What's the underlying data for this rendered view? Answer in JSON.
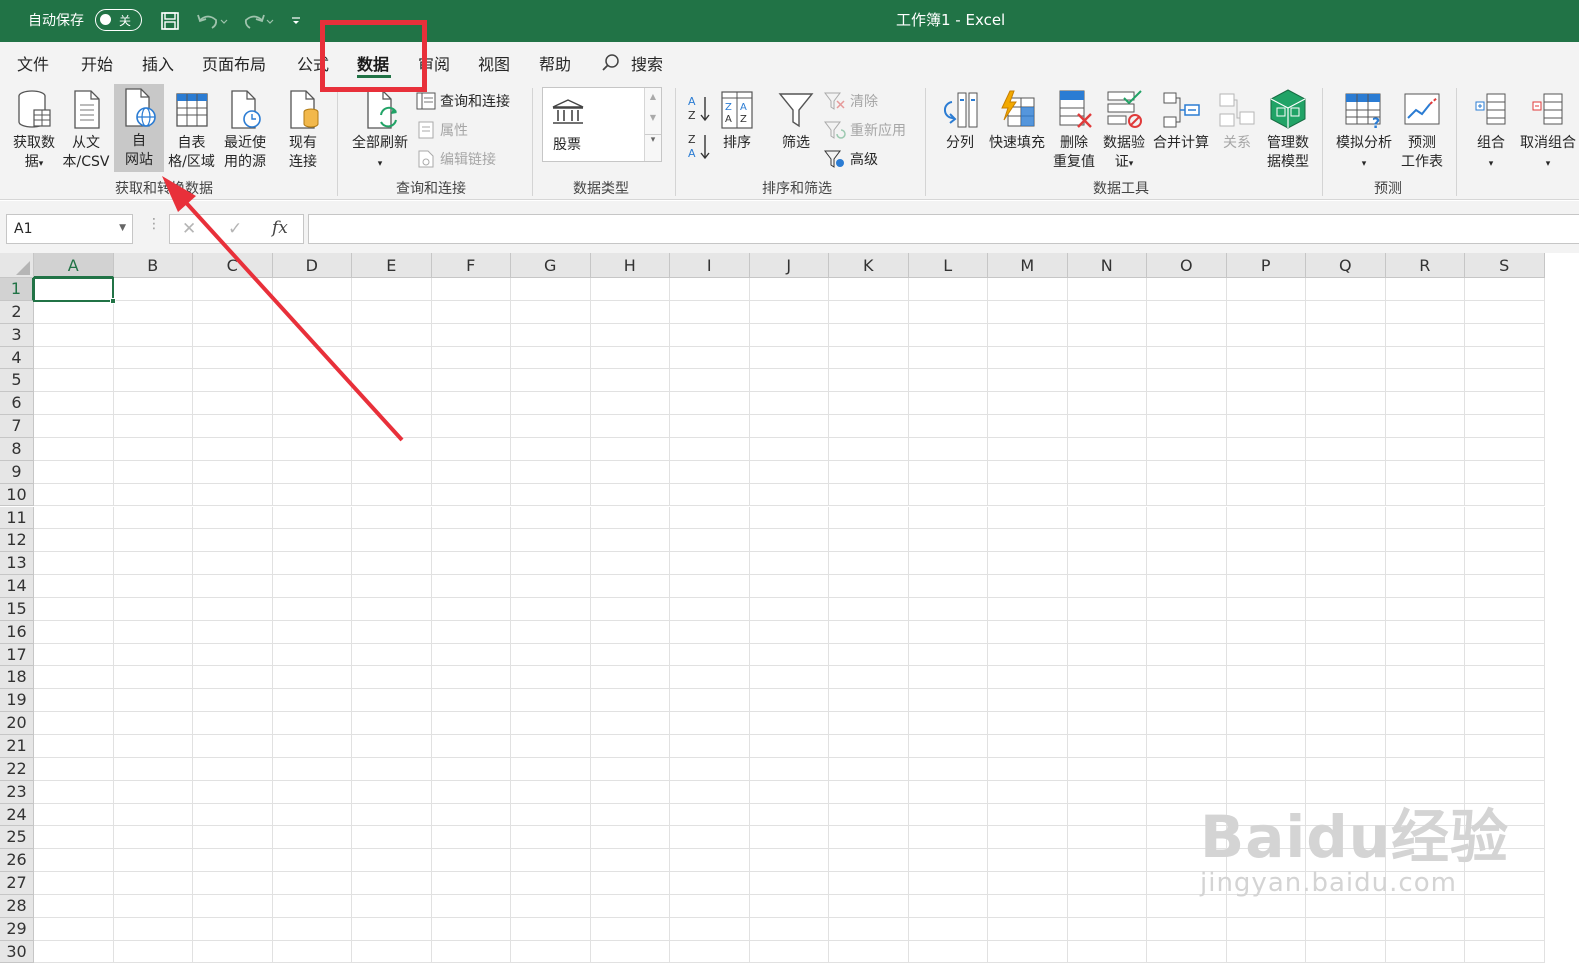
{
  "titlebar": {
    "autosave_label": "自动保存",
    "autosave_state": "关",
    "window_title": "工作簿1  -  Excel"
  },
  "tabs": [
    {
      "label": "文件"
    },
    {
      "label": "开始"
    },
    {
      "label": "插入"
    },
    {
      "label": "页面布局"
    },
    {
      "label": "公式"
    },
    {
      "label": "数据"
    },
    {
      "label": "审阅"
    },
    {
      "label": "视图"
    },
    {
      "label": "帮助"
    },
    {
      "label": "搜索"
    }
  ],
  "active_tab": "数据",
  "ribbon": {
    "get_data": {
      "group_label": "获取和转换数据",
      "buttons": [
        {
          "line1": "获取数",
          "line2": "据"
        },
        {
          "line1": "从文",
          "line2": "本/CSV"
        },
        {
          "line1": "自",
          "line2": "网站"
        },
        {
          "line1": "自表",
          "line2": "格/区域"
        },
        {
          "line1": "最近使",
          "line2": "用的源"
        },
        {
          "line1": "现有",
          "line2": "连接"
        }
      ]
    },
    "queries": {
      "group_label": "查询和连接",
      "refresh_all": "全部刷新",
      "queries_connections": "查询和连接",
      "properties": "属性",
      "edit_links": "编辑链接"
    },
    "data_types": {
      "group_label": "数据类型",
      "stocks": "股票"
    },
    "sort_filter": {
      "group_label": "排序和筛选",
      "sort": "排序",
      "filter": "筛选",
      "clear": "清除",
      "reapply": "重新应用",
      "advanced": "高级"
    },
    "data_tools": {
      "group_label": "数据工具",
      "buttons": [
        {
          "line1": "分列",
          "line2": ""
        },
        {
          "line1": "快速填充",
          "line2": ""
        },
        {
          "line1": "删除",
          "line2": "重复值"
        },
        {
          "line1": "数据验",
          "line2": "证"
        },
        {
          "line1": "合并计算",
          "line2": ""
        },
        {
          "line1": "关系",
          "line2": ""
        },
        {
          "line1": "管理数",
          "line2": "据模型"
        }
      ]
    },
    "forecast": {
      "group_label": "预测",
      "what_if": "模拟分析",
      "forecast_sheet_1": "预测",
      "forecast_sheet_2": "工作表"
    },
    "outline": {
      "group": "组合",
      "ungroup": "取消组合"
    }
  },
  "formula_bar": {
    "name_box": "A1",
    "cancel_symbol": "✕",
    "enter_symbol": "✓",
    "fx_symbol": "fx",
    "formula": ""
  },
  "sheet": {
    "columns": [
      "A",
      "B",
      "C",
      "D",
      "E",
      "F",
      "G",
      "H",
      "I",
      "J",
      "K",
      "L",
      "M",
      "N",
      "O",
      "P",
      "Q",
      "R",
      "S"
    ],
    "rows": [
      "1",
      "2",
      "3",
      "4",
      "5",
      "6",
      "7",
      "8",
      "9",
      "10",
      "11",
      "12",
      "13",
      "14",
      "15",
      "16",
      "17",
      "18",
      "19",
      "20",
      "21",
      "22",
      "23",
      "24",
      "25",
      "26",
      "27",
      "28",
      "29",
      "30"
    ],
    "active_cell": "A1"
  },
  "annotations": {
    "highlight_color": "#e8303a",
    "highlighted_tab": "数据",
    "arrow_target": "自网站"
  },
  "watermark": {
    "logo": "Baidu经验",
    "url": "jingyan.baidu.com"
  },
  "colors": {
    "excel_green": "#217346",
    "ribbon_bg": "#f3f3f3"
  }
}
